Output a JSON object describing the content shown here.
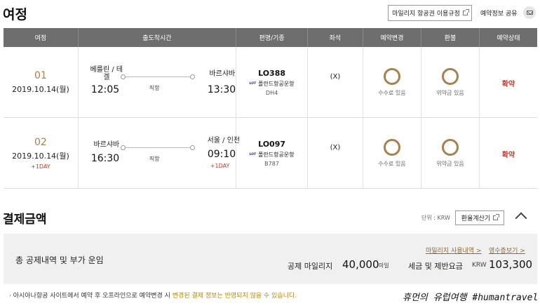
{
  "header": {
    "title": "여정",
    "mileage_rules_label": "마일리지 항공권 이용규정",
    "share_label": "예약정보 공유",
    "icons": {
      "external": "external-link-icon",
      "mail": "mail-icon"
    }
  },
  "table": {
    "columns": [
      "여정",
      "출도착시간",
      "편명/기종",
      "좌석",
      "예약변경",
      "환불",
      "예약상태"
    ],
    "segments": [
      {
        "number": "01",
        "date": "2019.10.14(월)",
        "date_extra": "",
        "origin": "베를린 / 테겔",
        "depart_time": "12:05",
        "route_type": "직항",
        "destination": "바르샤바",
        "arrive_time": "13:30",
        "arrive_extra": "",
        "flight_no": "LO388",
        "airline": "폴란드항공운항",
        "airline_logo": "LOT",
        "aircraft": "DH4",
        "seat": "(X)",
        "change_label": "수수료 있음",
        "refund_label": "위약금 있음",
        "status": "확약"
      },
      {
        "number": "02",
        "date": "2019.10.14(월)",
        "date_extra": "+1DAY",
        "origin": "바르샤바",
        "depart_time": "16:30",
        "route_type": "직항",
        "destination": "서울 / 인천",
        "arrive_time": "09:10",
        "arrive_extra": "+1DAY",
        "flight_no": "LO097",
        "airline": "폴란드항공운항",
        "airline_logo": "LOT",
        "aircraft": "B787",
        "seat": "(X)",
        "change_label": "수수료 있음",
        "refund_label": "위약금 있음",
        "status": "확약"
      }
    ]
  },
  "payment": {
    "title": "결제금액",
    "unit_label": "단위 : KRW",
    "calc_label": "환율계산기",
    "summary_label": "총 공제내역 및 부가 운임",
    "mileage_history_link": "마일리지 사용내역 >",
    "receipt_link": "영수증보기 >",
    "deducted_mileage_label": "공제 마일리지",
    "deducted_mileage_value": "40,000",
    "deducted_mileage_unit": "마일",
    "tax_label": "세금 및 제반요금",
    "tax_currency": "KRW",
    "tax_value": "103,300"
  },
  "notice": {
    "bullet": "·",
    "text_before": "아시아나항공 사이트에서 예약 후 오프라인으로 예약변경 시 ",
    "text_highlight": "변경된 결제 정보는 반영되지 않을 수 있습니다."
  },
  "watermark": "휴먼의 유럽여행 #humantravel",
  "colors": {
    "accent_gold": "#a8804f",
    "status_red": "#c0392b",
    "header_gray": "#6e6e6e"
  }
}
